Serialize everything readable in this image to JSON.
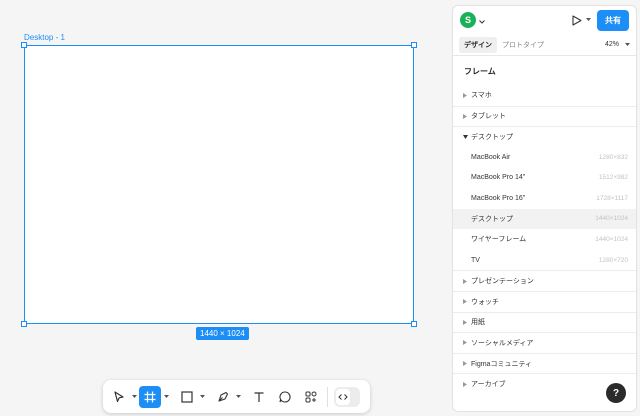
{
  "canvas": {
    "frame_label": "Desktop - 1",
    "size_badge": "1440 × 1024"
  },
  "toolbar": {
    "tools": [
      "move-tool",
      "frame-tool",
      "shape-tool",
      "pen-tool",
      "text-tool",
      "comment-tool",
      "actions-tool"
    ],
    "active_tool": "frame-tool"
  },
  "panel": {
    "avatar_initial": "S",
    "share_label": "共有",
    "tabs": [
      "デザイン",
      "プロトタイプ"
    ],
    "zoom": "42%",
    "section_title": "フレーム",
    "categories_top": [
      {
        "label": "スマホ"
      },
      {
        "label": "タブレット"
      },
      {
        "label": "デスクトップ"
      }
    ],
    "desktop_items": [
      {
        "label": "MacBook Air",
        "size": "1280×832"
      },
      {
        "label": "MacBook Pro 14\"",
        "size": "1512×982"
      },
      {
        "label": "MacBook Pro 16\"",
        "size": "1728×1117"
      },
      {
        "label": "デスクトップ",
        "size": "1440×1024"
      },
      {
        "label": "ワイヤーフレーム",
        "size": "1440×1024"
      },
      {
        "label": "TV",
        "size": "1280×720"
      }
    ],
    "categories_bottom": [
      {
        "label": "プレゼンテーション"
      },
      {
        "label": "ウォッチ"
      },
      {
        "label": "用紙"
      },
      {
        "label": "ソーシャルメディア"
      },
      {
        "label": "Figmaコミュニティ"
      },
      {
        "label": "アーカイブ"
      }
    ],
    "help_label": "?"
  },
  "colors": {
    "accent": "#1e8ef7",
    "avatar": "#1bb15b",
    "canvas_bg": "#f5f5f5"
  }
}
